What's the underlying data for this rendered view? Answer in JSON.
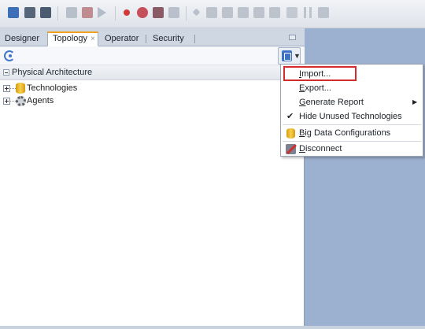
{
  "colors": {
    "background": "#9cb0cf",
    "active_tab_accent": "#f0a21c",
    "highlight_box": "#d52b2b"
  },
  "toolbar": {
    "icons": [
      "new-icon",
      "save-icon",
      "save-all-icon",
      "cut-icon",
      "debug-icon",
      "run-icon",
      "record-icon",
      "gear-icon",
      "bug-icon",
      "tools-icon",
      "step-icon",
      "step-over-icon",
      "step-into-icon",
      "step-out-icon",
      "grid-icon",
      "resume-icon",
      "pause-icon",
      "forward-icon"
    ]
  },
  "tabs": [
    {
      "label": "Designer"
    },
    {
      "label": "Topology",
      "active": true
    },
    {
      "label": "Operator"
    },
    {
      "label": "Security"
    }
  ],
  "tab_close_glyph": "×",
  "section": {
    "title": "Physical Architecture"
  },
  "tree": [
    {
      "label": "Technologies",
      "icon": "database-icon"
    },
    {
      "label": "Agents",
      "icon": "gear-icon"
    }
  ],
  "menu": {
    "items": [
      {
        "label": "Import...",
        "mnemonic": "I",
        "rest": "mport..."
      },
      {
        "label": "Export...",
        "mnemonic": "E",
        "rest": "xport..."
      },
      {
        "label": "Generate Report",
        "mnemonic": "G",
        "rest": "enerate Report",
        "has_submenu": true
      },
      {
        "label": "Hide Unused Technologies",
        "checked": true
      },
      {
        "label": "Big Data Configurations",
        "mnemonic": "B",
        "rest": "ig Data Configurations",
        "icon": "database-icon"
      },
      {
        "label": "Disconnect",
        "mnemonic": "D",
        "rest": "isconnect",
        "icon": "disconnect-icon"
      }
    ],
    "submenu_glyph": "▶",
    "check_glyph": "✔"
  }
}
